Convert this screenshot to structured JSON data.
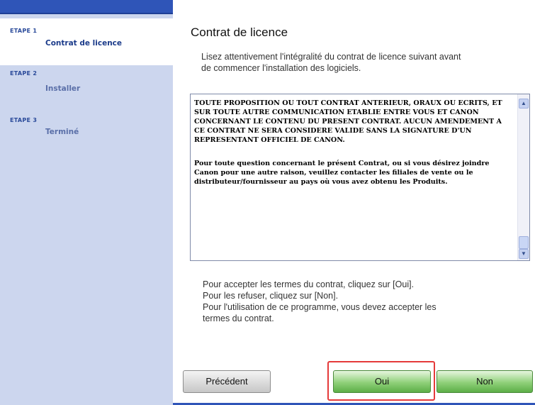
{
  "sidebar": {
    "steps": [
      {
        "head": "ETAPE 1",
        "label": "Contrat de licence",
        "active": true
      },
      {
        "head": "ETAPE 2",
        "label": "Installer",
        "active": false
      },
      {
        "head": "ETAPE 3",
        "label": "Terminé",
        "active": false
      }
    ]
  },
  "main": {
    "title": "Contrat de licence",
    "intro_line1": "Lisez attentivement l'intégralité du contrat de licence suivant avant",
    "intro_line2": "de commencer l'installation des logiciels.",
    "license": {
      "para1": "TOUTE PROPOSITION OU TOUT CONTRAT ANTERIEUR, ORAUX OU ECRITS, ET SUR TOUTE AUTRE COMMUNICATION ETABLIE ENTRE VOUS ET CANON CONCERNANT LE CONTENU DU PRESENT CONTRAT. AUCUN AMENDEMENT A CE CONTRAT NE SERA CONSIDERE VALIDE SANS LA SIGNATURE D'UN REPRESENTANT OFFICIEL DE CANON.",
      "para2": "Pour toute question concernant le présent Contrat, ou si vous désirez joindre Canon pour une autre raison, veuillez contacter les filiales de vente ou le distributeur/fournisseur au pays où vous avez obtenu les Produits."
    },
    "accept_line1": "Pour accepter les termes du contrat, cliquez sur [Oui].",
    "accept_line2": "Pour les refuser, cliquez sur [Non].",
    "accept_line3": "Pour l'utilisation de ce programme, vous devez accepter les",
    "accept_line4": "termes du contrat."
  },
  "buttons": {
    "previous": "Précédent",
    "yes": "Oui",
    "no": "Non"
  },
  "colors": {
    "highlight": "#e53a3a",
    "accent": "#2f55b8",
    "green_button": "#8fd079"
  }
}
